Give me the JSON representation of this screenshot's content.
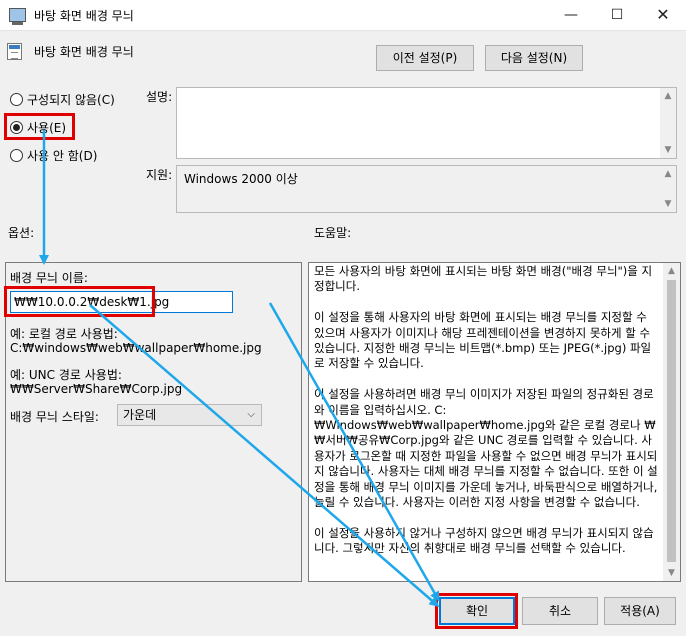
{
  "window": {
    "title": "바탕 화면 배경 무늬",
    "minimize": "—",
    "maximize": "☐",
    "close": "✕"
  },
  "header": {
    "title": "바탕 화면 배경 무늬",
    "prev_setting": "이전 설정(P)",
    "next_setting": "다음 설정(N)"
  },
  "state": {
    "options": [
      {
        "label": "구성되지 않음(C)",
        "selected": false
      },
      {
        "label": "사용(E)",
        "selected": true
      },
      {
        "label": "사용 안 함(D)",
        "selected": false
      }
    ]
  },
  "comment": {
    "label": "설명:",
    "value": ""
  },
  "supported": {
    "label": "지원:",
    "value": "Windows 2000 이상"
  },
  "options_section": {
    "label": "옵션:",
    "wallpaper_name_label": "배경 무늬 이름:",
    "wallpaper_name_value": "₩₩10.0.0.2₩desk₩1.jpg",
    "local_example_label": "예: 로컬 경로 사용법:",
    "local_example_path": "C:₩windows₩web₩wallpaper₩home.jpg",
    "unc_example_label": "예: UNC 경로 사용법:",
    "unc_example_path": "₩₩Server₩Share₩Corp.jpg",
    "style_label": "배경 무늬 스타일:",
    "style_value": "가운데"
  },
  "help_section": {
    "label": "도움말:",
    "text": "모든 사용자의 바탕 화면에 표시되는 바탕 화면 배경(\"배경 무늬\")을 지정합니다.\n\n이 설정을 통해 사용자의 바탕 화면에 표시되는 배경 무늬를 지정할 수 있으며 사용자가 이미지나 해당 프레젠테이션을 변경하지 못하게 할 수 있습니다. 지정한 배경 무늬는 비트맵(*.bmp) 또는 JPEG(*.jpg) 파일로 저장할 수 있습니다.\n\n이 설정을 사용하려면 배경 무늬 이미지가 저장된 파일의 정규화된 경로와 이름을 입력하십시오. C:₩Windows₩web₩wallpaper₩home.jpg와 같은 로컬 경로나 ₩₩서버₩공유₩Corp.jpg와 같은 UNC 경로를 입력할 수 있습니다. 사용자가 로그온할 때 지정한 파일을 사용할 수 없으면 배경 무늬가 표시되지 않습니다. 사용자는 대체 배경 무늬를 지정할 수 없습니다. 또한 이 설정을 통해 배경 무늬 이미지를 가운데 놓거나, 바둑판식으로 배열하거나, 늘릴 수 있습니다. 사용자는 이러한 지정 사항을 변경할 수 없습니다.\n\n이 설정을 사용하지 않거나 구성하지 않으면 배경 무늬가 표시되지 않습니다. 그렇지만 자신의 취향대로 배경 무늬를 선택할 수 있습니다."
  },
  "footer": {
    "ok": "확인",
    "cancel": "취소",
    "apply": "적용(A)"
  },
  "annotations": {
    "highlight_color": "#e00000",
    "arrow_color": "#1ea7ea"
  }
}
